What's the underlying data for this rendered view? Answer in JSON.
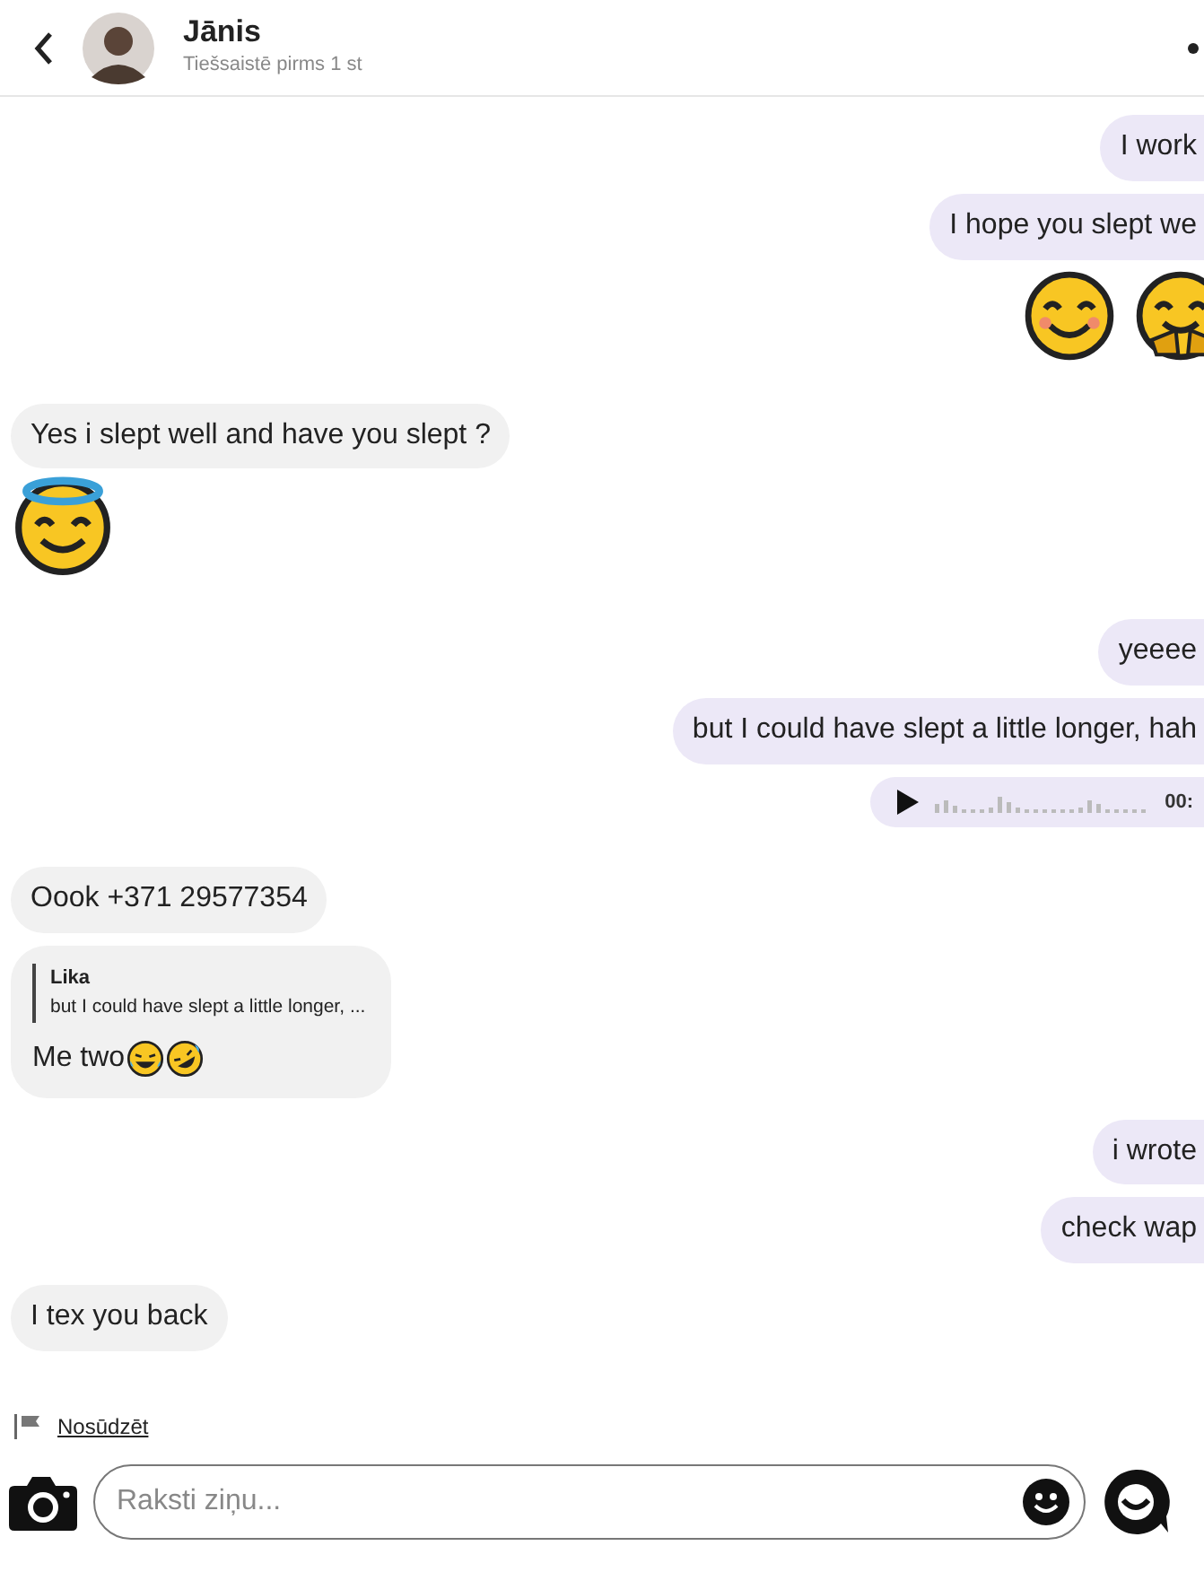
{
  "header": {
    "name": "Jānis",
    "status": "Tiešsaistē pirms 1 st"
  },
  "messages": [
    {
      "kind": "text",
      "outgoing": true,
      "text": "I work"
    },
    {
      "kind": "text",
      "outgoing": true,
      "text": "I hope you slept we"
    },
    {
      "kind": "emoji",
      "outgoing": true
    },
    {
      "kind": "text",
      "outgoing": false,
      "text": "Yes i slept well and have you slept ?"
    },
    {
      "kind": "emoji",
      "outgoing": false
    },
    {
      "kind": "text",
      "outgoing": true,
      "text": "yeeee"
    },
    {
      "kind": "text",
      "outgoing": true,
      "text": "but I could have slept a little longer, hah"
    },
    {
      "kind": "voice",
      "outgoing": true,
      "duration": "00:"
    },
    {
      "kind": "text",
      "outgoing": false,
      "text": "Oook +371 29577354"
    },
    {
      "kind": "reply",
      "outgoing": false,
      "quote_author": "Lika",
      "quote_text": "but I could have slept a little longer, ...",
      "text": "Me two"
    },
    {
      "kind": "text",
      "outgoing": true,
      "text": "i wrote"
    },
    {
      "kind": "text",
      "outgoing": true,
      "text": "check wap"
    },
    {
      "kind": "text",
      "outgoing": false,
      "text": "I tex you back"
    }
  ],
  "report_link": "Nosūdzēt",
  "composer": {
    "placeholder": "Raksti ziņu..."
  }
}
